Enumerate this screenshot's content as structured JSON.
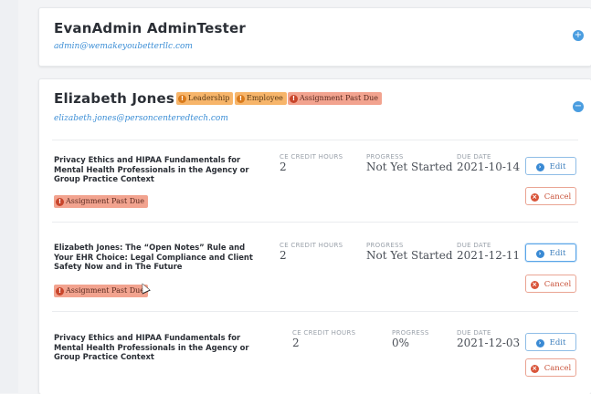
{
  "users": [
    {
      "name": "EvanAdmin AdminTester",
      "email": "admin@wemakeyoubetterllc.com",
      "toggle_icon": "plus-circle-icon",
      "expanded": false
    },
    {
      "name": "Elizabeth Jones",
      "email": "elizabeth.jones@personcenteredtech.com",
      "toggle_icon": "minus-circle-icon",
      "expanded": true,
      "badges": [
        "Leadership",
        "Employee",
        "Assignment Past Due"
      ],
      "courses": [
        {
          "title": "Privacy Ethics and HIPAA Fundamentals for Mental Health Professionals in the Agency or Group Practice Context",
          "ce_credit_hours_label": "CE CREDIT HOURS",
          "ce_credit_hours": "2",
          "progress_label": "PROGRESS",
          "progress": "Not Yet Started",
          "due_date_label": "DUE DATE",
          "due_date": "2021-10-14",
          "badge": "Assignment Past Due",
          "edit_label": "Edit",
          "cancel_label": "Cancel"
        },
        {
          "title": "Elizabeth Jones: The “Open Notes” Rule and Your EHR Choice: Legal Compliance and Client Safety Now and in The Future",
          "ce_credit_hours_label": "CE CREDIT HOURS",
          "ce_credit_hours": "2",
          "progress_label": "PROGRESS",
          "progress": "Not Yet Started",
          "due_date_label": "DUE DATE",
          "due_date": "2021-12-11",
          "badge": "Assignment Past Due",
          "edit_label": "Edit",
          "cancel_label": "Cancel"
        },
        {
          "title": "Privacy Ethics and HIPAA Fundamentals for Mental Health Professionals in the Agency or Group Practice Context",
          "ce_credit_hours_label": "CE CREDIT HOURS",
          "ce_credit_hours": "2",
          "progress_label": "PROGRESS",
          "progress": "0%",
          "due_date_label": "DUE DATE",
          "due_date": "2021-12-03",
          "edit_label": "Edit",
          "cancel_label": "Cancel"
        }
      ]
    }
  ],
  "colors": {
    "accent": "#3a8ad4",
    "badge_orange": "#f7b56a",
    "badge_red": "#f2a38f",
    "cancel": "#d9553a"
  }
}
